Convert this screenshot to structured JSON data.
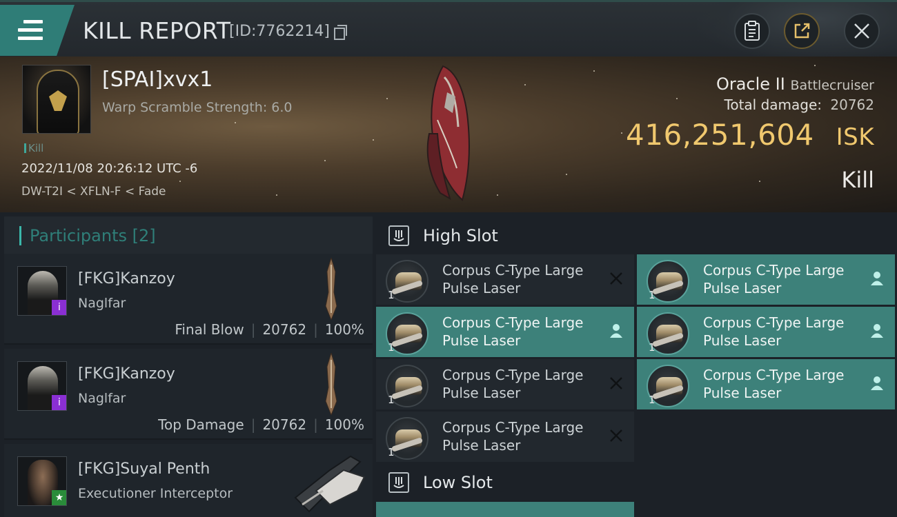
{
  "header": {
    "title": "KILL REPORT",
    "report_id": "[ID:7762214]"
  },
  "victim": {
    "name": "[SPAI]xvx1",
    "warp_scramble": "Warp Scramble Strength: 6.0",
    "kill_tag": "Kill",
    "datetime": "2022/11/08 20:26:12 UTC -6",
    "location": "DW-T2I < XFLN-F < Fade",
    "ship_name": "Oracle II",
    "ship_class": "Battlecruiser",
    "total_damage_label": "Total damage:",
    "total_damage": "20762",
    "isk_value": "416,251,604",
    "isk_unit": "ISK",
    "result": "Kill"
  },
  "participants": {
    "title": "Participants",
    "count": "[2]",
    "rows": [
      {
        "name": "[FKG]Kanzoy",
        "ship": "Naglfar",
        "role": "Final Blow",
        "damage": "20762",
        "percent": "100%",
        "badge": "i"
      },
      {
        "name": "[FKG]Kanzoy",
        "ship": "Naglfar",
        "role": "Top Damage",
        "damage": "20762",
        "percent": "100%",
        "badge": "i"
      },
      {
        "name": "[FKG]Suyal Penth",
        "ship": "Executioner Interceptor",
        "badge": "★"
      }
    ]
  },
  "fittings": {
    "high_slot_label": "High Slot",
    "low_slot_label": "Low Slot",
    "high_slots": [
      {
        "name": "Corpus C-Type Large Pulse Laser",
        "qty": "1",
        "state": "destroyed",
        "active": false
      },
      {
        "name": "Corpus C-Type Large Pulse Laser",
        "qty": "1",
        "state": "dropped",
        "active": true
      },
      {
        "name": "Corpus C-Type Large Pulse Laser",
        "qty": "1",
        "state": "dropped",
        "active": true
      },
      {
        "name": "Corpus C-Type Large Pulse Laser",
        "qty": "1",
        "state": "dropped",
        "active": true
      },
      {
        "name": "Corpus C-Type Large Pulse Laser",
        "qty": "1",
        "state": "destroyed",
        "active": false
      },
      {
        "name": "Corpus C-Type Large Pulse Laser",
        "qty": "1",
        "state": "dropped",
        "active": true
      },
      {
        "name": "Corpus C-Type Large Pulse Laser",
        "qty": "1",
        "state": "destroyed",
        "active": false
      }
    ]
  },
  "colors": {
    "accent": "#3d817a",
    "isk": "#f0c86e",
    "badge_purple": "#8a2fd3",
    "badge_green": "#2a8c3a"
  }
}
